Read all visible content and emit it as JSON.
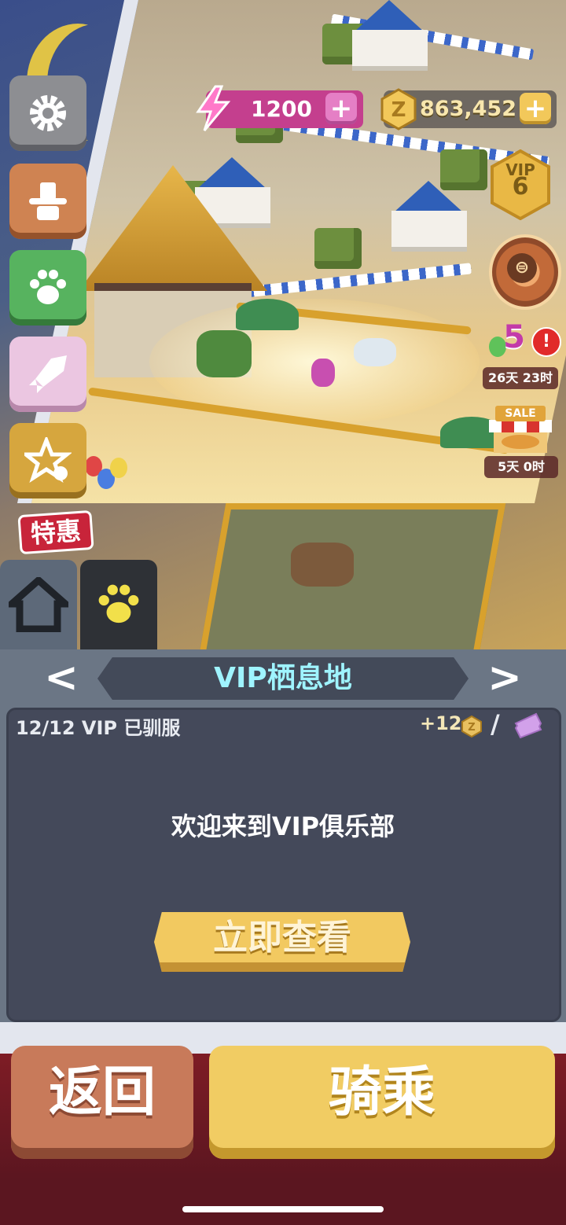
{
  "hud": {
    "energy_value": "1200",
    "energy_plus": "+",
    "coin_value": "863,452",
    "coin_plus": "+",
    "vip_label": "VIP",
    "vip_level": "6"
  },
  "events": {
    "event_count": "5",
    "alert_symbol": "!",
    "event_timer": "26天 23时",
    "sale_label": "SALE",
    "sale_timer": "5天 0时"
  },
  "side_menu": {
    "special_offer": "特惠",
    "items": [
      "settings",
      "profile",
      "pets",
      "rocket",
      "achievements"
    ]
  },
  "tabs": [
    "home",
    "paw"
  ],
  "panel": {
    "title": "VIP栖息地",
    "prev_arrow": "<",
    "next_arrow": ">",
    "tamed_count": "12/12 VIP 已驯服",
    "reward": "+12",
    "slash": "/",
    "welcome": "欢迎来到VIP俱乐部",
    "view_now": "立即查看"
  },
  "actions": {
    "back": "返回",
    "ride": "骑乘"
  },
  "colors": {
    "energy": "#c43f8e",
    "coin": "#f2c85a",
    "title_text": "#9ff4ff",
    "panel_bg": "#44495a",
    "back_button": "#c87a5a",
    "ride_button": "#f1cc63"
  }
}
